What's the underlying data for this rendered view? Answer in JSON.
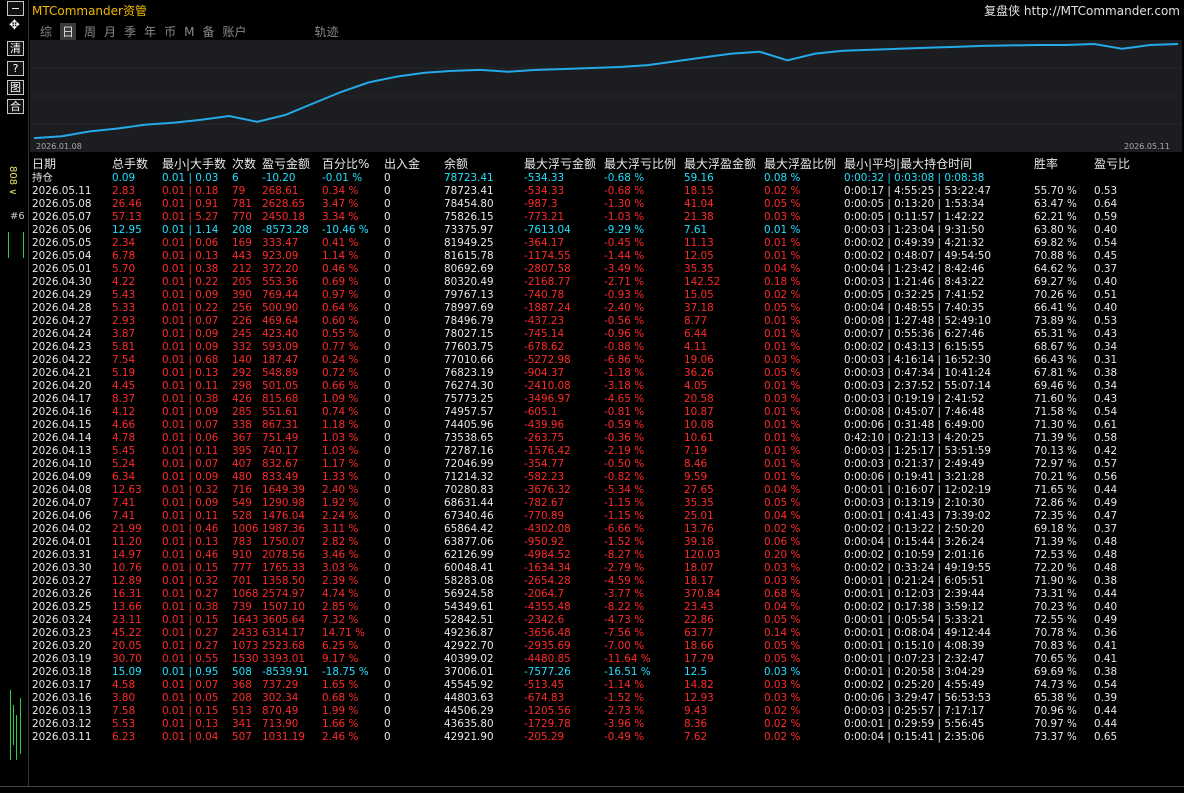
{
  "window": {
    "title": "MTCommander资管",
    "brand": "复盘侠 http://MTCommander.com"
  },
  "leftbar": {
    "buttons": [
      "−",
      "✥",
      "清",
      "?",
      "图",
      "合"
    ],
    "vertical_label": "808 ∨",
    "side_label": "#6"
  },
  "tabs": [
    {
      "label": "综",
      "active": false
    },
    {
      "label": "日",
      "active": true
    },
    {
      "label": "周",
      "active": false
    },
    {
      "label": "月",
      "active": false
    },
    {
      "label": "季",
      "active": false
    },
    {
      "label": "年",
      "active": false
    },
    {
      "label": "币",
      "active": false
    },
    {
      "label": "M",
      "active": false
    },
    {
      "label": "备",
      "active": false
    },
    {
      "label": "账户",
      "active": false
    }
  ],
  "track_tab": "轨迹",
  "chart_data": {
    "type": "line",
    "x": [
      "2026.01.08",
      "2026.05.11"
    ],
    "series": [
      {
        "values": [
          0.02,
          0.04,
          0.09,
          0.12,
          0.16,
          0.18,
          0.21,
          0.25,
          0.19,
          0.26,
          0.38,
          0.5,
          0.6,
          0.66,
          0.7,
          0.72,
          0.73,
          0.71,
          0.73,
          0.74,
          0.75,
          0.76,
          0.78,
          0.82,
          0.86,
          0.9,
          0.92,
          0.83,
          0.9,
          0.93,
          0.94,
          0.95,
          0.96,
          0.97,
          0.98,
          0.985,
          0.99,
          0.99,
          1.0,
          0.95,
          0.99,
          1.0
        ]
      }
    ],
    "color": "#25a9e8"
  },
  "chart_labels": {
    "start": "2026.01.08",
    "end": "2026.05.11"
  },
  "table": {
    "headers": [
      "日期",
      "总手数",
      "最小|大手数",
      "次数",
      "盈亏金额",
      "百分比%",
      "出入金",
      "余额",
      "最大浮亏金额",
      "最大浮亏比例",
      "最大浮盈金额",
      "最大浮盈比例",
      "最小|平均|最大持仓时间",
      "胜率",
      "盈亏比"
    ],
    "hold": [
      "持仓",
      "0.09",
      "0.01 | 0.03",
      "6",
      "-10.20",
      "-0.01 %",
      "0",
      "78723.41",
      "-534.33",
      "-0.68 %",
      "59.16",
      "0.08 %",
      "0:00:32 | 0:03:08 | 0:08:38",
      "",
      ""
    ],
    "rows": [
      [
        "2026.05.11",
        "2.83",
        "0.01 | 0.18",
        "79",
        "268.61",
        "0.34 %",
        "0",
        "78723.41",
        "-534.33",
        "-0.68 %",
        "18.15",
        "0.02 %",
        "0:00:17 | 4:55:25 | 53:22:47",
        "55.70 %",
        "0.53"
      ],
      [
        "2026.05.08",
        "26.46",
        "0.01 | 0.91",
        "781",
        "2628.65",
        "3.47 %",
        "0",
        "78454.80",
        "-987.3",
        "-1.30 %",
        "41.04",
        "0.05 %",
        "0:00:05 | 0:13:20 | 1:53:34",
        "63.47 %",
        "0.64"
      ],
      [
        "2026.05.07",
        "57.13",
        "0.01 | 5.27",
        "770",
        "2450.18",
        "3.34 %",
        "0",
        "75826.15",
        "-773.21",
        "-1.03 %",
        "21.38",
        "0.03 %",
        "0:00:05 | 0:11:57 | 1:42:22",
        "62.21 %",
        "0.59"
      ],
      [
        "2026.05.06",
        "12.95",
        "0.01 | 1.14",
        "208",
        "-8573.28",
        "-10.46 %",
        "0",
        "73375.97",
        "-7613.04",
        "-9.29 %",
        "7.61",
        "0.01 %",
        "0:00:03 | 1:23:04 | 9:31:50",
        "63.80 %",
        "0.40"
      ],
      [
        "2026.05.05",
        "2.34",
        "0.01 | 0.06",
        "169",
        "333.47",
        "0.41 %",
        "0",
        "81949.25",
        "-364.17",
        "-0.45 %",
        "11.13",
        "0.01 %",
        "0:00:02 | 0:49:39 | 4:21:32",
        "69.82 %",
        "0.54"
      ],
      [
        "2026.05.04",
        "6.78",
        "0.01 | 0.13",
        "443",
        "923.09",
        "1.14 %",
        "0",
        "81615.78",
        "-1174.55",
        "-1.44 %",
        "12.05",
        "0.01 %",
        "0:00:02 | 0:48:07 | 49:54:50",
        "70.88 %",
        "0.45"
      ],
      [
        "2026.05.01",
        "5.70",
        "0.01 | 0.38",
        "212",
        "372.20",
        "0.46 %",
        "0",
        "80692.69",
        "-2807.58",
        "-3.49 %",
        "35.35",
        "0.04 %",
        "0:00:04 | 1:23:42 | 8:42:46",
        "64.62 %",
        "0.37"
      ],
      [
        "2026.04.30",
        "4.22",
        "0.01 | 0.22",
        "205",
        "553.36",
        "0.69 %",
        "0",
        "80320.49",
        "-2168.77",
        "-2.71 %",
        "142.52",
        "0.18 %",
        "0:00:03 | 1:21:46 | 8:43:22",
        "69.27 %",
        "0.40"
      ],
      [
        "2026.04.29",
        "5.43",
        "0.01 | 0.09",
        "390",
        "769.44",
        "0.97 %",
        "0",
        "79767.13",
        "-740.78",
        "-0.93 %",
        "15.05",
        "0.02 %",
        "0:00:05 | 0:32:25 | 7:41:52",
        "70.26 %",
        "0.51"
      ],
      [
        "2026.04.28",
        "5.33",
        "0.01 | 0.22",
        "256",
        "500.90",
        "0.64 %",
        "0",
        "78997.69",
        "-1887.24",
        "-2.40 %",
        "37.18",
        "0.05 %",
        "0:00:04 | 0:48:55 | 7:40:35",
        "66.41 %",
        "0.40"
      ],
      [
        "2026.04.27",
        "2.93",
        "0.01 | 0.07",
        "226",
        "469.64",
        "0.60 %",
        "0",
        "78496.79",
        "-437.23",
        "-0.56 %",
        "8.77",
        "0.01 %",
        "0:00:08 | 1:27:48 | 52:49:10",
        "73.89 %",
        "0.53"
      ],
      [
        "2026.04.24",
        "3.87",
        "0.01 | 0.09",
        "245",
        "423.40",
        "0.55 %",
        "0",
        "78027.15",
        "-745.14",
        "-0.96 %",
        "6.44",
        "0.01 %",
        "0:00:07 | 0:55:36 | 6:27:46",
        "65.31 %",
        "0.43"
      ],
      [
        "2026.04.23",
        "5.81",
        "0.01 | 0.09",
        "332",
        "593.09",
        "0.77 %",
        "0",
        "77603.75",
        "-678.62",
        "-0.88 %",
        "4.11",
        "0.01 %",
        "0:00:02 | 0:43:13 | 6:15:55",
        "68.67 %",
        "0.34"
      ],
      [
        "2026.04.22",
        "7.54",
        "0.01 | 0.68",
        "140",
        "187.47",
        "0.24 %",
        "0",
        "77010.66",
        "-5272.98",
        "-6.86 %",
        "19.06",
        "0.03 %",
        "0:00:03 | 4:16:14 | 16:52:30",
        "66.43 %",
        "0.31"
      ],
      [
        "2026.04.21",
        "5.19",
        "0.01 | 0.13",
        "292",
        "548.89",
        "0.72 %",
        "0",
        "76823.19",
        "-904.37",
        "-1.18 %",
        "36.26",
        "0.05 %",
        "0:00:03 | 0:47:34 | 10:41:24",
        "67.81 %",
        "0.38"
      ],
      [
        "2026.04.20",
        "4.45",
        "0.01 | 0.11",
        "298",
        "501.05",
        "0.66 %",
        "0",
        "76274.30",
        "-2410.08",
        "-3.18 %",
        "4.05",
        "0.01 %",
        "0:00:03 | 2:37:52 | 55:07:14",
        "69.46 %",
        "0.34"
      ],
      [
        "2026.04.17",
        "8.37",
        "0.01 | 0.38",
        "426",
        "815.68",
        "1.09 %",
        "0",
        "75773.25",
        "-3496.97",
        "-4.65 %",
        "20.58",
        "0.03 %",
        "0:00:03 | 0:19:19 | 2:41:52",
        "71.60 %",
        "0.43"
      ],
      [
        "2026.04.16",
        "4.12",
        "0.01 | 0.09",
        "285",
        "551.61",
        "0.74 %",
        "0",
        "74957.57",
        "-605.1",
        "-0.81 %",
        "10.87",
        "0.01 %",
        "0:00:08 | 0:45:07 | 7:46:48",
        "71.58 %",
        "0.54"
      ],
      [
        "2026.04.15",
        "4.66",
        "0.01 | 0.07",
        "338",
        "867.31",
        "1.18 %",
        "0",
        "74405.96",
        "-439.96",
        "-0.59 %",
        "10.08",
        "0.01 %",
        "0:00:06 | 0:31:48 | 6:49:00",
        "71.30 %",
        "0.61"
      ],
      [
        "2026.04.14",
        "4.78",
        "0.01 | 0.06",
        "367",
        "751.49",
        "1.03 %",
        "0",
        "73538.65",
        "-263.75",
        "-0.36 %",
        "10.61",
        "0.01 %",
        "0:42:10 | 0:21:13 | 4:20:25",
        "71.39 %",
        "0.58"
      ],
      [
        "2026.04.13",
        "5.45",
        "0.01 | 0.11",
        "395",
        "740.17",
        "1.03 %",
        "0",
        "72787.16",
        "-1576.42",
        "-2.19 %",
        "7.19",
        "0.01 %",
        "0:00:03 | 1:25:17 | 53:51:59",
        "70.13 %",
        "0.42"
      ],
      [
        "2026.04.10",
        "5.24",
        "0.01 | 0.07",
        "407",
        "832.67",
        "1.17 %",
        "0",
        "72046.99",
        "-354.77",
        "-0.50 %",
        "8.46",
        "0.01 %",
        "0:00:03 | 0:21:37 | 2:49:49",
        "72.97 %",
        "0.57"
      ],
      [
        "2026.04.09",
        "6.34",
        "0.01 | 0.09",
        "480",
        "833.49",
        "1.33 %",
        "0",
        "71214.32",
        "-582.23",
        "-0.82 %",
        "9.59",
        "0.01 %",
        "0:00:06 | 0:19:41 | 3:21:28",
        "70.21 %",
        "0.56"
      ],
      [
        "2026.04.08",
        "12.63",
        "0.01 | 0.32",
        "716",
        "1649.39",
        "2.40 %",
        "0",
        "70280.83",
        "-3676.32",
        "-5.34 %",
        "27.65",
        "0.04 %",
        "0:00:01 | 0:16:07 | 12:02:19",
        "71.65 %",
        "0.44"
      ],
      [
        "2026.04.07",
        "7.41",
        "0.01 | 0.09",
        "549",
        "1290.98",
        "1.92 %",
        "0",
        "68631.44",
        "-782.67",
        "-1.15 %",
        "35.35",
        "0.05 %",
        "0:00:03 | 0:13:19 | 2:10:30",
        "72.86 %",
        "0.49"
      ],
      [
        "2026.04.06",
        "7.41",
        "0.01 | 0.11",
        "528",
        "1476.04",
        "2.24 %",
        "0",
        "67340.46",
        "-770.89",
        "-1.15 %",
        "25.01",
        "0.04 %",
        "0:00:01 | 0:41:43 | 73:39:02",
        "72.35 %",
        "0.47"
      ],
      [
        "2026.04.02",
        "21.99",
        "0.01 | 0.46",
        "1006",
        "1987.36",
        "3.11 %",
        "0",
        "65864.42",
        "-4302.08",
        "-6.66 %",
        "13.76",
        "0.02 %",
        "0:00:02 | 0:13:22 | 2:50:20",
        "69.18 %",
        "0.37"
      ],
      [
        "2026.04.01",
        "11.20",
        "0.01 | 0.13",
        "783",
        "1750.07",
        "2.82 %",
        "0",
        "63877.06",
        "-950.92",
        "-1.52 %",
        "39.18",
        "0.06 %",
        "0:00:04 | 0:15:44 | 3:26:24",
        "71.39 %",
        "0.48"
      ],
      [
        "2026.03.31",
        "14.97",
        "0.01 | 0.46",
        "910",
        "2078.56",
        "3.46 %",
        "0",
        "62126.99",
        "-4984.52",
        "-8.27 %",
        "120.03",
        "0.20 %",
        "0:00:02 | 0:10:59 | 2:01:16",
        "72.53 %",
        "0.48"
      ],
      [
        "2026.03.30",
        "10.76",
        "0.01 | 0.15",
        "777",
        "1765.33",
        "3.03 %",
        "0",
        "60048.41",
        "-1634.34",
        "-2.79 %",
        "18.07",
        "0.03 %",
        "0:00:02 | 0:33:24 | 49:19:55",
        "72.20 %",
        "0.48"
      ],
      [
        "2026.03.27",
        "12.89",
        "0.01 | 0.32",
        "701",
        "1358.50",
        "2.39 %",
        "0",
        "58283.08",
        "-2654.28",
        "-4.59 %",
        "18.17",
        "0.03 %",
        "0:00:01 | 0:21:24 | 6:05:51",
        "71.90 %",
        "0.38"
      ],
      [
        "2026.03.26",
        "16.31",
        "0.01 | 0.27",
        "1068",
        "2574.97",
        "4.74 %",
        "0",
        "56924.58",
        "-2064.7",
        "-3.77 %",
        "370.84",
        "0.68 %",
        "0:00:01 | 0:12:03 | 2:39:44",
        "73.31 %",
        "0.44"
      ],
      [
        "2026.03.25",
        "13.66",
        "0.01 | 0.38",
        "739",
        "1507.10",
        "2.85 %",
        "0",
        "54349.61",
        "-4355.48",
        "-8.22 %",
        "23.43",
        "0.04 %",
        "0:00:02 | 0:17:38 | 3:59:12",
        "70.23 %",
        "0.40"
      ],
      [
        "2026.03.24",
        "23.11",
        "0.01 | 0.15",
        "1643",
        "3605.64",
        "7.32 %",
        "0",
        "52842.51",
        "-2342.6",
        "-4.73 %",
        "22.86",
        "0.05 %",
        "0:00:01 | 0:05:54 | 5:33:21",
        "72.55 %",
        "0.49"
      ],
      [
        "2026.03.23",
        "45.22",
        "0.01 | 0.27",
        "2433",
        "6314.17",
        "14.71 %",
        "0",
        "49236.87",
        "-3656.48",
        "-7.56 %",
        "63.77",
        "0.14 %",
        "0:00:01 | 0:08:04 | 49:12:44",
        "70.78 %",
        "0.36"
      ],
      [
        "2026.03.20",
        "20.05",
        "0.01 | 0.27",
        "1073",
        "2523.68",
        "6.25 %",
        "0",
        "42922.70",
        "-2935.69",
        "-7.00 %",
        "18.66",
        "0.05 %",
        "0:00:01 | 0:15:10 | 4:08:39",
        "70.83 %",
        "0.41"
      ],
      [
        "2026.03.19",
        "30.70",
        "0.01 | 0.55",
        "1530",
        "3393.01",
        "9.17 %",
        "0",
        "40399.02",
        "-4480.85",
        "-11.64 %",
        "17.79",
        "0.05 %",
        "0:00:01 | 0:07:23 | 2:32:47",
        "70.65 %",
        "0.41"
      ],
      [
        "2026.03.18",
        "15.09",
        "0.01 | 0.95",
        "508",
        "-8539.91",
        "-18.75 %",
        "0",
        "37006.01",
        "-7577.26",
        "-16.51 %",
        "12.5",
        "0.03 %",
        "0:00:01 | 0:20:58 | 3:04:29",
        "69.69 %",
        "0.38"
      ],
      [
        "2026.03.17",
        "4.58",
        "0.01 | 0.07",
        "368",
        "737.29",
        "1.65 %",
        "0",
        "45545.92",
        "-513.45",
        "-1.14 %",
        "14.82",
        "0.03 %",
        "0:00:02 | 0:25:20 | 4:55:49",
        "74.73 %",
        "0.54"
      ],
      [
        "2026.03.16",
        "3.80",
        "0.01 | 0.05",
        "208",
        "302.34",
        "0.68 %",
        "0",
        "44803.63",
        "-674.83",
        "-1.52 %",
        "12.93",
        "0.03 %",
        "0:00:06 | 3:29:47 | 56:53:53",
        "65.38 %",
        "0.39"
      ],
      [
        "2026.03.13",
        "7.58",
        "0.01 | 0.15",
        "513",
        "870.49",
        "1.99 %",
        "0",
        "44506.29",
        "-1205.56",
        "-2.73 %",
        "9.43",
        "0.02 %",
        "0:00:03 | 0:25:57 | 7:17:17",
        "70.96 %",
        "0.44"
      ],
      [
        "2026.03.12",
        "5.53",
        "0.01 | 0.13",
        "341",
        "713.90",
        "1.66 %",
        "0",
        "43635.80",
        "-1729.78",
        "-3.96 %",
        "8.36",
        "0.02 %",
        "0:00:01 | 0:29:59 | 5:56:45",
        "70.97 %",
        "0.44"
      ],
      [
        "2026.03.11",
        "6.23",
        "0.01 | 0.04",
        "507",
        "1031.19",
        "2.46 %",
        "0",
        "42921.90",
        "-205.29",
        "-0.49 %",
        "7.62",
        "0.02 %",
        "0:00:04 | 0:15:41 | 2:35:06",
        "73.37 %",
        "0.65"
      ]
    ]
  }
}
